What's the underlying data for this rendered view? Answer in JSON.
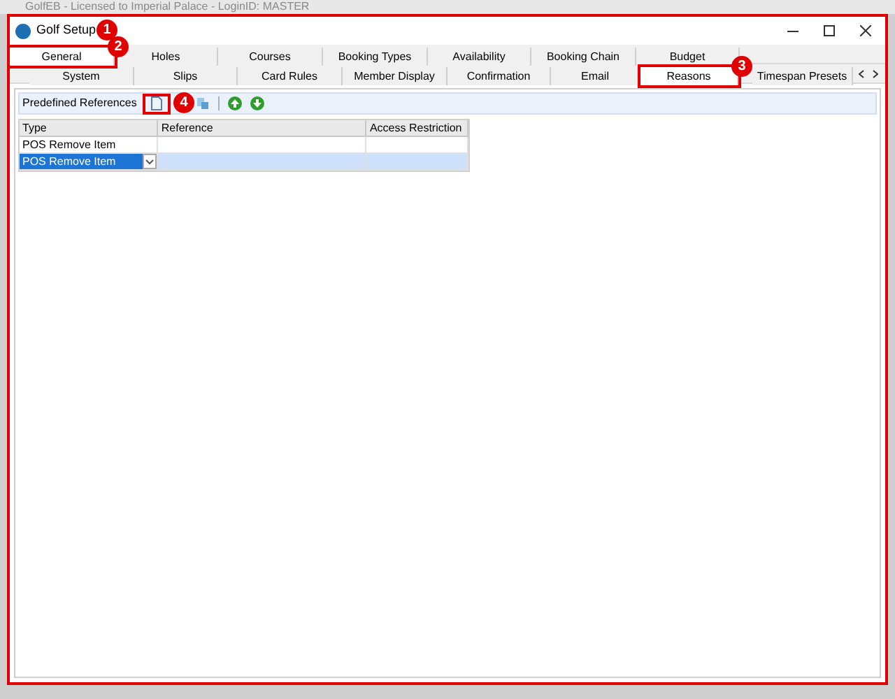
{
  "app_title": "GolfEB - Licensed to Imperial Palace - LoginID: MASTER",
  "window": {
    "title": "Golf Setup",
    "marker": "1"
  },
  "tabs_row_1": [
    {
      "label": "General",
      "selected": true,
      "marker": "2"
    },
    {
      "label": "Holes",
      "selected": false
    },
    {
      "label": "Courses",
      "selected": false
    },
    {
      "label": "Booking Types",
      "selected": false
    },
    {
      "label": "Availability",
      "selected": false
    },
    {
      "label": "Booking Chain",
      "selected": false
    },
    {
      "label": "Budget",
      "selected": false
    }
  ],
  "tabs_row_2": [
    {
      "label": "System",
      "selected": false
    },
    {
      "label": "Slips",
      "selected": false
    },
    {
      "label": "Card Rules",
      "selected": false
    },
    {
      "label": "Member Display",
      "selected": false
    },
    {
      "label": "Confirmation",
      "selected": false
    },
    {
      "label": "Email",
      "selected": false
    },
    {
      "label": "Reasons",
      "selected": true,
      "marker": "3"
    },
    {
      "label": "Timespan Presets",
      "selected": false
    }
  ],
  "toolbar": {
    "label": "Predefined References",
    "new_marker": "4"
  },
  "table": {
    "columns": [
      "Type",
      "Reference",
      "Access Restriction"
    ],
    "rows": [
      {
        "cells": [
          "POS Remove Item",
          "",
          ""
        ],
        "selected": false
      },
      {
        "cells": [
          "POS Remove Item",
          "",
          ""
        ],
        "selected": true
      }
    ]
  }
}
